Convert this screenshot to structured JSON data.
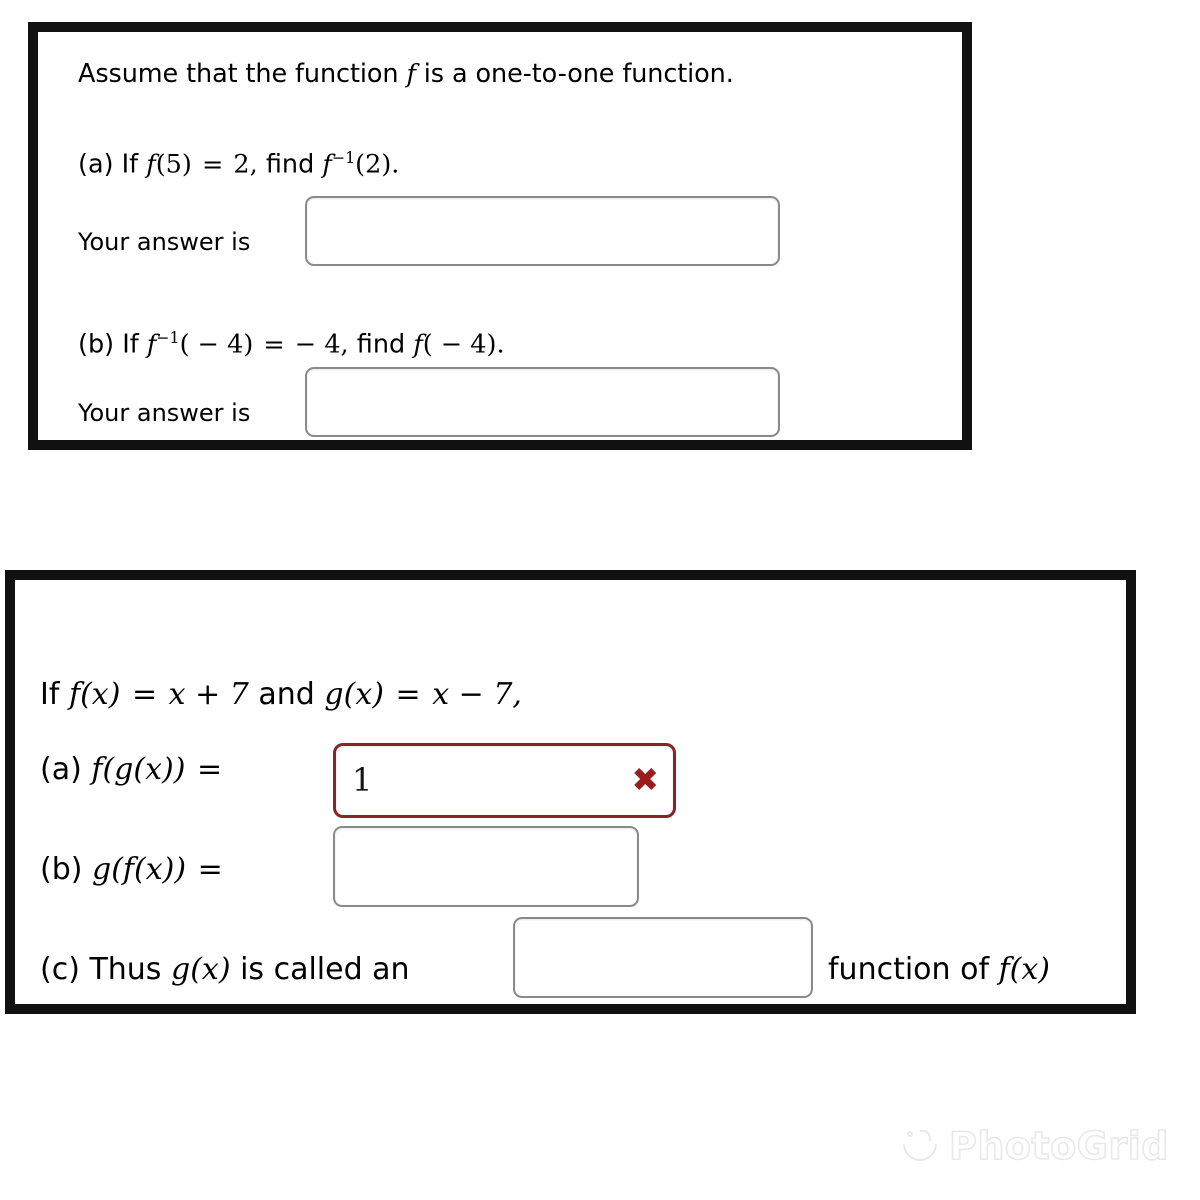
{
  "problem_one": {
    "title": "Assume that the function f is a one-to-one function.",
    "title_plain": "Assume that the function",
    "title_fn": "f",
    "title_tail": "is a one-to-one function.",
    "part_a": {
      "label": "(a)",
      "lead": "If",
      "given_fn": "f",
      "given_arg": "(5)",
      "equals": "=",
      "given_value": "2,",
      "find_word": "find",
      "find_fn": "f",
      "find_exp": "−1",
      "find_arg": "(2).",
      "answer_label": "Your answer is",
      "answer_value": "",
      "answer_placeholder": ""
    },
    "part_b": {
      "label": "(b)",
      "lead": "If",
      "given_fn": "f",
      "given_exp": "−1",
      "given_arg": "( − 4)",
      "equals": "=",
      "given_value": "− 4,",
      "find_word": "find",
      "find_fn": "f",
      "find_arg": "( − 4).",
      "answer_label": "Your answer is",
      "answer_value": "",
      "answer_placeholder": ""
    }
  },
  "problem_two": {
    "condition": {
      "lead": "If",
      "f_fn": "f",
      "f_arg": "(x)",
      "eq1": "=",
      "f_expr": "x + 7",
      "conj": "and",
      "g_fn": "g",
      "g_arg": "(x)",
      "eq2": "=",
      "g_expr": "x − 7,"
    },
    "part_a": {
      "label": "(a)",
      "expr_outer": "f",
      "expr_inner": "(g(x))",
      "equals": "=",
      "answer_value": "1",
      "answer_placeholder": "",
      "status": "incorrect",
      "status_icon": "x-mark-icon",
      "status_color": "#9b1c1c"
    },
    "part_b": {
      "label": "(b)",
      "expr_outer": "g",
      "expr_inner": "(f(x))",
      "equals": "=",
      "answer_value": "",
      "answer_placeholder": ""
    },
    "part_c": {
      "label": "(c)",
      "lead": "Thus",
      "g_fn": "g",
      "g_arg": "(x)",
      "middle": "is called an",
      "answer_value": "",
      "answer_placeholder": "",
      "tail": "function of",
      "tail_fn": "f",
      "tail_arg": "(x)"
    }
  },
  "watermark": {
    "text": "PhotoGrid",
    "logo_icon": "photogrid-bowl-icon"
  },
  "colors": {
    "panel_border": "#111111",
    "input_border": "#8a8a8a",
    "input_border_error": "#8f2025",
    "error_mark": "#9b1c1c",
    "background": "#ffffff",
    "text": "#000000",
    "watermark": "#e8e8e8"
  }
}
